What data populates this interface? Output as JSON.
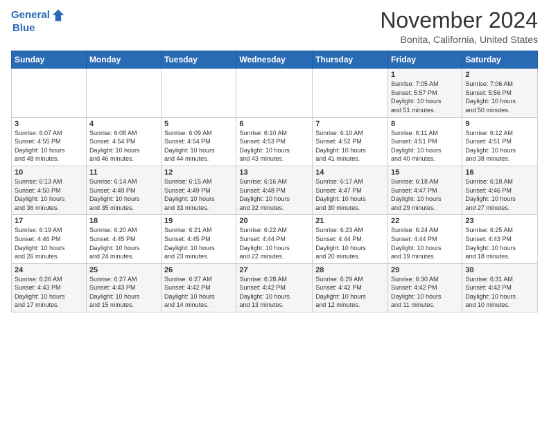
{
  "header": {
    "logo_line1": "General",
    "logo_line2": "Blue",
    "month": "November 2024",
    "location": "Bonita, California, United States"
  },
  "weekdays": [
    "Sunday",
    "Monday",
    "Tuesday",
    "Wednesday",
    "Thursday",
    "Friday",
    "Saturday"
  ],
  "weeks": [
    [
      {
        "day": "",
        "info": ""
      },
      {
        "day": "",
        "info": ""
      },
      {
        "day": "",
        "info": ""
      },
      {
        "day": "",
        "info": ""
      },
      {
        "day": "",
        "info": ""
      },
      {
        "day": "1",
        "info": "Sunrise: 7:05 AM\nSunset: 5:57 PM\nDaylight: 10 hours\nand 51 minutes."
      },
      {
        "day": "2",
        "info": "Sunrise: 7:06 AM\nSunset: 5:56 PM\nDaylight: 10 hours\nand 50 minutes."
      }
    ],
    [
      {
        "day": "3",
        "info": "Sunrise: 6:07 AM\nSunset: 4:55 PM\nDaylight: 10 hours\nand 48 minutes."
      },
      {
        "day": "4",
        "info": "Sunrise: 6:08 AM\nSunset: 4:54 PM\nDaylight: 10 hours\nand 46 minutes."
      },
      {
        "day": "5",
        "info": "Sunrise: 6:09 AM\nSunset: 4:54 PM\nDaylight: 10 hours\nand 44 minutes."
      },
      {
        "day": "6",
        "info": "Sunrise: 6:10 AM\nSunset: 4:53 PM\nDaylight: 10 hours\nand 43 minutes."
      },
      {
        "day": "7",
        "info": "Sunrise: 6:10 AM\nSunset: 4:52 PM\nDaylight: 10 hours\nand 41 minutes."
      },
      {
        "day": "8",
        "info": "Sunrise: 6:11 AM\nSunset: 4:51 PM\nDaylight: 10 hours\nand 40 minutes."
      },
      {
        "day": "9",
        "info": "Sunrise: 6:12 AM\nSunset: 4:51 PM\nDaylight: 10 hours\nand 38 minutes."
      }
    ],
    [
      {
        "day": "10",
        "info": "Sunrise: 6:13 AM\nSunset: 4:50 PM\nDaylight: 10 hours\nand 36 minutes."
      },
      {
        "day": "11",
        "info": "Sunrise: 6:14 AM\nSunset: 4:49 PM\nDaylight: 10 hours\nand 35 minutes."
      },
      {
        "day": "12",
        "info": "Sunrise: 6:15 AM\nSunset: 4:49 PM\nDaylight: 10 hours\nand 33 minutes."
      },
      {
        "day": "13",
        "info": "Sunrise: 6:16 AM\nSunset: 4:48 PM\nDaylight: 10 hours\nand 32 minutes."
      },
      {
        "day": "14",
        "info": "Sunrise: 6:17 AM\nSunset: 4:47 PM\nDaylight: 10 hours\nand 30 minutes."
      },
      {
        "day": "15",
        "info": "Sunrise: 6:18 AM\nSunset: 4:47 PM\nDaylight: 10 hours\nand 29 minutes."
      },
      {
        "day": "16",
        "info": "Sunrise: 6:18 AM\nSunset: 4:46 PM\nDaylight: 10 hours\nand 27 minutes."
      }
    ],
    [
      {
        "day": "17",
        "info": "Sunrise: 6:19 AM\nSunset: 4:46 PM\nDaylight: 10 hours\nand 26 minutes."
      },
      {
        "day": "18",
        "info": "Sunrise: 6:20 AM\nSunset: 4:45 PM\nDaylight: 10 hours\nand 24 minutes."
      },
      {
        "day": "19",
        "info": "Sunrise: 6:21 AM\nSunset: 4:45 PM\nDaylight: 10 hours\nand 23 minutes."
      },
      {
        "day": "20",
        "info": "Sunrise: 6:22 AM\nSunset: 4:44 PM\nDaylight: 10 hours\nand 22 minutes."
      },
      {
        "day": "21",
        "info": "Sunrise: 6:23 AM\nSunset: 4:44 PM\nDaylight: 10 hours\nand 20 minutes."
      },
      {
        "day": "22",
        "info": "Sunrise: 6:24 AM\nSunset: 4:44 PM\nDaylight: 10 hours\nand 19 minutes."
      },
      {
        "day": "23",
        "info": "Sunrise: 6:25 AM\nSunset: 4:43 PM\nDaylight: 10 hours\nand 18 minutes."
      }
    ],
    [
      {
        "day": "24",
        "info": "Sunrise: 6:26 AM\nSunset: 4:43 PM\nDaylight: 10 hours\nand 17 minutes."
      },
      {
        "day": "25",
        "info": "Sunrise: 6:27 AM\nSunset: 4:43 PM\nDaylight: 10 hours\nand 15 minutes."
      },
      {
        "day": "26",
        "info": "Sunrise: 6:27 AM\nSunset: 4:42 PM\nDaylight: 10 hours\nand 14 minutes."
      },
      {
        "day": "27",
        "info": "Sunrise: 6:28 AM\nSunset: 4:42 PM\nDaylight: 10 hours\nand 13 minutes."
      },
      {
        "day": "28",
        "info": "Sunrise: 6:29 AM\nSunset: 4:42 PM\nDaylight: 10 hours\nand 12 minutes."
      },
      {
        "day": "29",
        "info": "Sunrise: 6:30 AM\nSunset: 4:42 PM\nDaylight: 10 hours\nand 11 minutes."
      },
      {
        "day": "30",
        "info": "Sunrise: 6:31 AM\nSunset: 4:42 PM\nDaylight: 10 hours\nand 10 minutes."
      }
    ]
  ]
}
